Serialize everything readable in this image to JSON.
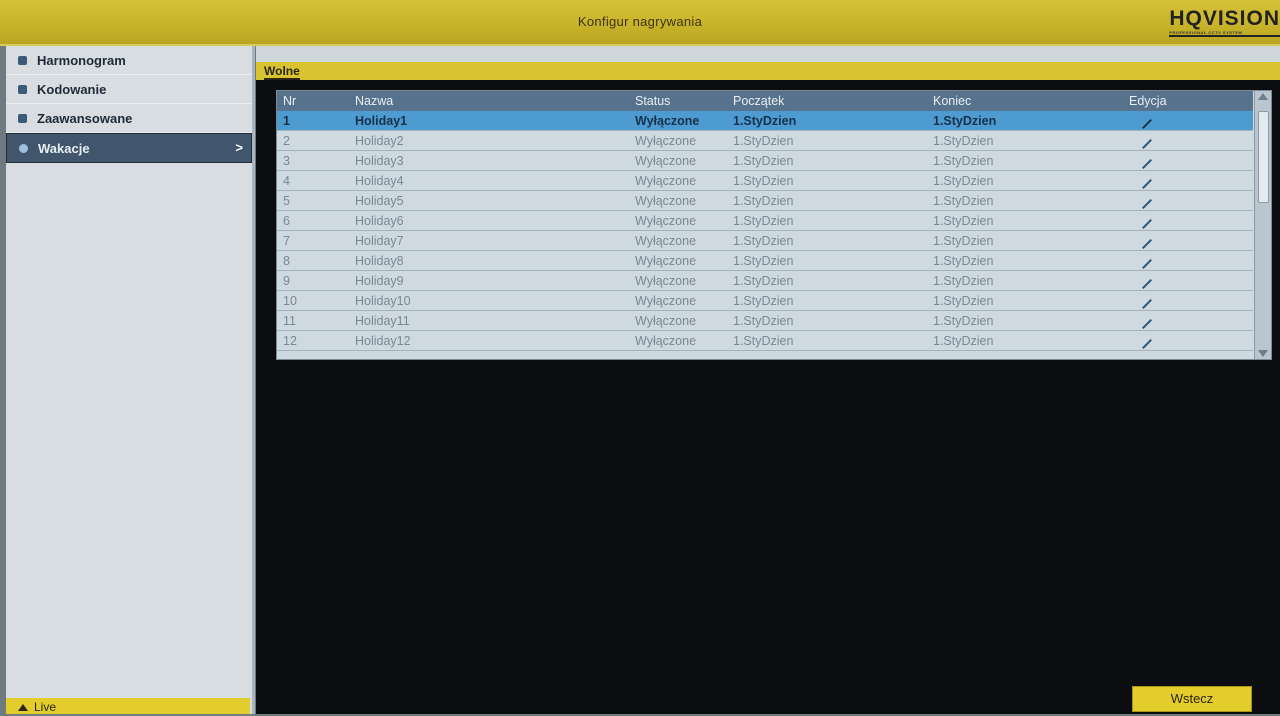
{
  "window": {
    "title": "Konfigur nagrywania",
    "brand": "HQVISION",
    "brand_tagline": "PROFESSIONAL CCTV SYSTEM"
  },
  "sidebar": {
    "items": [
      {
        "label": "Harmonogram",
        "icon": "calendar-icon"
      },
      {
        "label": "Kodowanie",
        "icon": "gear-icon"
      },
      {
        "label": "Zaawansowane",
        "icon": "gears-icon"
      },
      {
        "label": "Wakacje",
        "icon": "holiday-icon",
        "active": true
      }
    ],
    "chevron": ">",
    "footer_label": "Live"
  },
  "main": {
    "tab_label": "Wolne",
    "table": {
      "columns": [
        "Nr",
        "Nazwa",
        "Status",
        "Początek",
        "Koniec",
        "Edycja"
      ],
      "rows": [
        {
          "nr": "1",
          "name": "Holiday1",
          "status": "Wyłączone",
          "start": "1.StyDzien",
          "end": "1.StyDzien",
          "selected": true
        },
        {
          "nr": "2",
          "name": "Holiday2",
          "status": "Wyłączone",
          "start": "1.StyDzien",
          "end": "1.StyDzien"
        },
        {
          "nr": "3",
          "name": "Holiday3",
          "status": "Wyłączone",
          "start": "1.StyDzien",
          "end": "1.StyDzien"
        },
        {
          "nr": "4",
          "name": "Holiday4",
          "status": "Wyłączone",
          "start": "1.StyDzien",
          "end": "1.StyDzien"
        },
        {
          "nr": "5",
          "name": "Holiday5",
          "status": "Wyłączone",
          "start": "1.StyDzien",
          "end": "1.StyDzien"
        },
        {
          "nr": "6",
          "name": "Holiday6",
          "status": "Wyłączone",
          "start": "1.StyDzien",
          "end": "1.StyDzien"
        },
        {
          "nr": "7",
          "name": "Holiday7",
          "status": "Wyłączone",
          "start": "1.StyDzien",
          "end": "1.StyDzien"
        },
        {
          "nr": "8",
          "name": "Holiday8",
          "status": "Wyłączone",
          "start": "1.StyDzien",
          "end": "1.StyDzien"
        },
        {
          "nr": "9",
          "name": "Holiday9",
          "status": "Wyłączone",
          "start": "1.StyDzien",
          "end": "1.StyDzien"
        },
        {
          "nr": "10",
          "name": "Holiday10",
          "status": "Wyłączone",
          "start": "1.StyDzien",
          "end": "1.StyDzien"
        },
        {
          "nr": "11",
          "name": "Holiday11",
          "status": "Wyłączone",
          "start": "1.StyDzien",
          "end": "1.StyDzien"
        },
        {
          "nr": "12",
          "name": "Holiday12",
          "status": "Wyłączone",
          "start": "1.StyDzien",
          "end": "1.StyDzien"
        }
      ]
    },
    "back_label": "Wstecz"
  },
  "colors": {
    "accent": "#d8c430",
    "selection": "#4e9bd2",
    "header": "#56728d",
    "active_nav": "#41566c"
  }
}
